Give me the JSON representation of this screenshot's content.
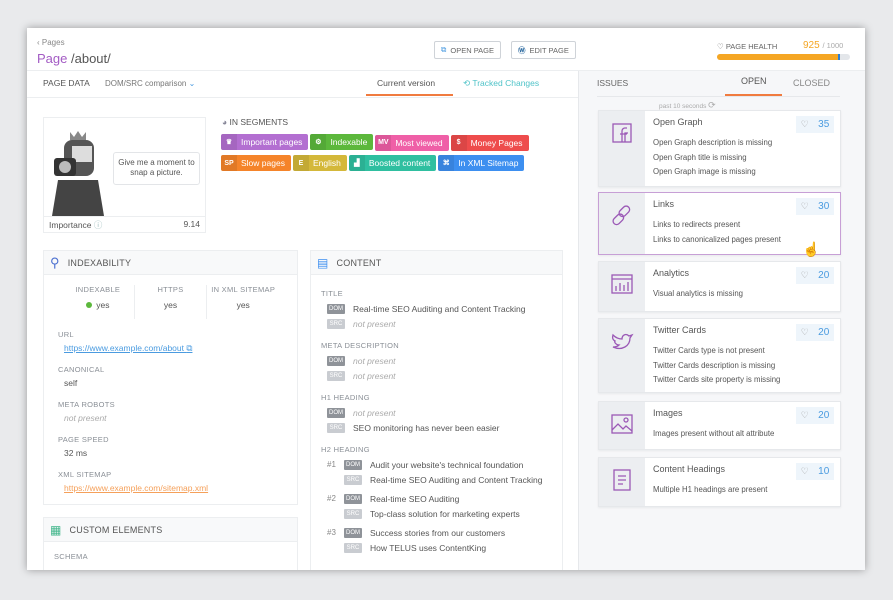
{
  "header": {
    "back": "Pages",
    "page_label": "Page",
    "page_path": "/about/",
    "open_page": "OPEN PAGE",
    "edit_page": "EDIT PAGE"
  },
  "health": {
    "label": "PAGE HEALTH",
    "score": "925",
    "max": "/ 1000",
    "fraction": 0.925,
    "bar_color": "#f5a623"
  },
  "left_tabs": {
    "page_data": "PAGE DATA",
    "comparison": "DOM/SRC comparison",
    "current": "Current version",
    "tracked": "Tracked Changes"
  },
  "screenshot": {
    "bubble": "Give me a moment to snap a picture.",
    "importance_label": "Importance",
    "importance": "9.14"
  },
  "segments": {
    "title": "IN SEGMENTS",
    "items": [
      {
        "icon": "crown-icon",
        "abbr": "♛",
        "label": "Important pages",
        "color": "#b36fd1"
      },
      {
        "icon": "robot-icon",
        "abbr": "⚙",
        "label": "Indexable",
        "color": "#5cb83c"
      },
      {
        "icon": "mv",
        "abbr": "MV",
        "label": "Most viewed",
        "color": "#ef5fa7"
      },
      {
        "icon": "money-bag-icon",
        "abbr": "$",
        "label": "Money Pages",
        "color": "#ee4c4c"
      },
      {
        "icon": "sp",
        "abbr": "SP",
        "label": "Slow pages",
        "color": "#f5842a"
      },
      {
        "icon": "e",
        "abbr": "E",
        "label": "English",
        "color": "#d4b83a"
      },
      {
        "icon": "chart-icon",
        "abbr": "▟",
        "label": "Boosted content",
        "color": "#2fbfa0"
      },
      {
        "icon": "sitemap-icon",
        "abbr": "⌘",
        "label": "In XML Sitemap",
        "color": "#3d8ff0"
      }
    ]
  },
  "indexability": {
    "title": "INDEXABILITY",
    "cols": [
      {
        "label": "INDEXABLE",
        "value": "yes"
      },
      {
        "label": "HTTPS",
        "value": "yes"
      },
      {
        "label": "IN XML SITEMAP",
        "value": "yes"
      }
    ],
    "url_label": "URL",
    "url": "https://www.example.com/about",
    "canonical_label": "CANONICAL",
    "canonical": "self",
    "robots_label": "META ROBOTS",
    "robots": "not present",
    "speed_label": "PAGE SPEED",
    "speed": "32 ms",
    "sitemap_label": "XML SITEMAP",
    "sitemap": "https://www.example.com/sitemap.xml"
  },
  "custom": {
    "title": "CUSTOM ELEMENTS",
    "schema": "SCHEMA"
  },
  "content": {
    "title": "CONTENT",
    "dom": "DOM",
    "src": "SRC",
    "title_label": "TITLE",
    "title_dom": "Real-time SEO Auditing and Content Tracking",
    "title_src": "not present",
    "meta_label": "META DESCRIPTION",
    "meta_dom": "not present",
    "meta_src": "not present",
    "h1_label": "H1 HEADING",
    "h1_dom": "not present",
    "h1_src": "SEO monitoring has never been easier",
    "h2_label": "H2 HEADING",
    "h2": [
      {
        "n": "#1",
        "dom": "Audit your website's technical foundation",
        "src": "Real-time SEO Auditing and Content Tracking"
      },
      {
        "n": "#2",
        "dom": "Real-time SEO Auditing",
        "src": "Top-class solution for marketing experts"
      },
      {
        "n": "#3",
        "dom": "Success stories from our customers",
        "src": "How TELUS uses ContentKing"
      }
    ]
  },
  "issues": {
    "title": "ISSUES",
    "open": "OPEN",
    "closed": "CLOSED",
    "updated": "past 10 seconds",
    "cards": [
      {
        "icon": "facebook-icon",
        "title": "Open Graph",
        "score": "35",
        "items": [
          "Open Graph description is missing",
          "Open Graph title is missing",
          "Open Graph image is missing"
        ]
      },
      {
        "icon": "link-icon",
        "title": "Links",
        "score": "30",
        "items": [
          "Links to redirects present",
          "Links to canonicalized pages present"
        ]
      },
      {
        "icon": "analytics-icon",
        "title": "Analytics",
        "score": "20",
        "items": [
          "Visual analytics is missing"
        ]
      },
      {
        "icon": "twitter-icon",
        "title": "Twitter Cards",
        "score": "20",
        "items": [
          "Twitter Cards type is not present",
          "Twitter Cards description is missing",
          "Twitter Cards site property is missing"
        ]
      },
      {
        "icon": "image-icon",
        "title": "Images",
        "score": "20",
        "items": [
          "Images present without alt attribute"
        ]
      },
      {
        "icon": "document-icon",
        "title": "Content Headings",
        "score": "10",
        "items": [
          "Multiple H1 headings are present"
        ]
      }
    ]
  }
}
